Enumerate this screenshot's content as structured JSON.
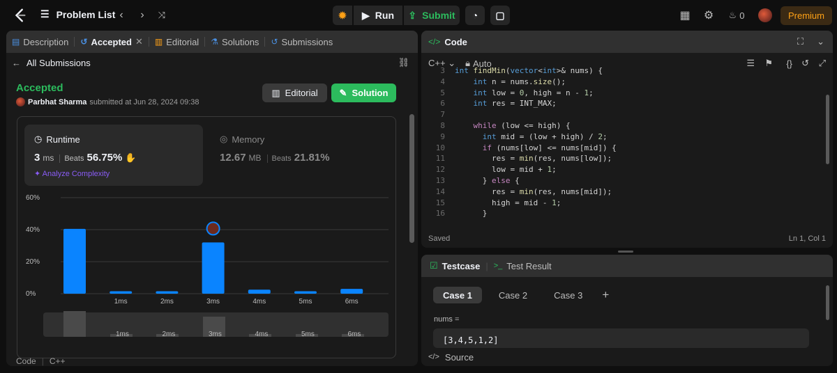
{
  "topbar": {
    "problem_list": "Problem List",
    "run": "Run",
    "submit": "Submit",
    "streak_count": "0",
    "premium": "Premium"
  },
  "left_tabs": [
    {
      "label": "Description",
      "icon": "description-icon"
    },
    {
      "label": "Accepted",
      "icon": "history-icon"
    },
    {
      "label": "Editorial",
      "icon": "book-icon"
    },
    {
      "label": "Solutions",
      "icon": "flask-icon"
    },
    {
      "label": "Submissions",
      "icon": "history-icon"
    }
  ],
  "submission": {
    "back_label": "All Submissions",
    "status": "Accepted",
    "user": "Parbhat Sharma",
    "submitted_text": "submitted at Jun 28, 2024 09:38",
    "editorial_btn": "Editorial",
    "solution_btn": "Solution"
  },
  "runtime": {
    "title": "Runtime",
    "value": "3",
    "unit": "ms",
    "beats_label": "Beats",
    "beats_value": "56.75%",
    "analyze": "Analyze Complexity"
  },
  "memory": {
    "title": "Memory",
    "value": "12.67",
    "unit": "MB",
    "beats_label": "Beats",
    "beats_value": "21.81%"
  },
  "chart_data": {
    "type": "bar",
    "categories": [
      "",
      "1ms",
      "2ms",
      "3ms",
      "4ms",
      "5ms",
      "6ms"
    ],
    "values": [
      40.5,
      1.5,
      1.5,
      32,
      2.5,
      1.5,
      3
    ],
    "ylim": [
      0,
      60
    ],
    "yticks": [
      "60%",
      "40%",
      "20%",
      "0%"
    ],
    "highlight_index": 3,
    "bar_color": "#0a84ff",
    "grid": true
  },
  "mini_chart": {
    "labels": [
      "1ms",
      "2ms",
      "3ms",
      "4ms",
      "5ms",
      "6ms"
    ]
  },
  "code_footer": {
    "label": "Code",
    "lang": "C++"
  },
  "code_panel": {
    "title": "Code",
    "language": "C++",
    "mode": "Auto",
    "status_saved": "Saved",
    "cursor": "Ln 1, Col 1"
  },
  "code_lines": [
    {
      "n": "3",
      "t": "int findMin(vector<int>& nums) {"
    },
    {
      "n": "4",
      "t": "    int n = nums.size();"
    },
    {
      "n": "5",
      "t": "    int low = 0, high = n - 1;"
    },
    {
      "n": "6",
      "t": "    int res = INT_MAX;"
    },
    {
      "n": "7",
      "t": ""
    },
    {
      "n": "8",
      "t": "    while (low <= high) {"
    },
    {
      "n": "9",
      "t": "      int mid = (low + high) / 2;"
    },
    {
      "n": "10",
      "t": "      if (nums[low] <= nums[mid]) {"
    },
    {
      "n": "11",
      "t": "        res = min(res, nums[low]);"
    },
    {
      "n": "12",
      "t": "        low = mid + 1;"
    },
    {
      "n": "13",
      "t": "      } else {"
    },
    {
      "n": "14",
      "t": "        res = min(res, nums[mid]);"
    },
    {
      "n": "15",
      "t": "        high = mid - 1;"
    },
    {
      "n": "16",
      "t": "      }"
    }
  ],
  "testcase_panel": {
    "tab_testcase": "Testcase",
    "tab_result": "Test Result",
    "cases": [
      "Case 1",
      "Case 2",
      "Case 3"
    ],
    "add": "+",
    "nums_label": "nums =",
    "nums_value": "[3,4,5,1,2]",
    "source": "Source"
  }
}
